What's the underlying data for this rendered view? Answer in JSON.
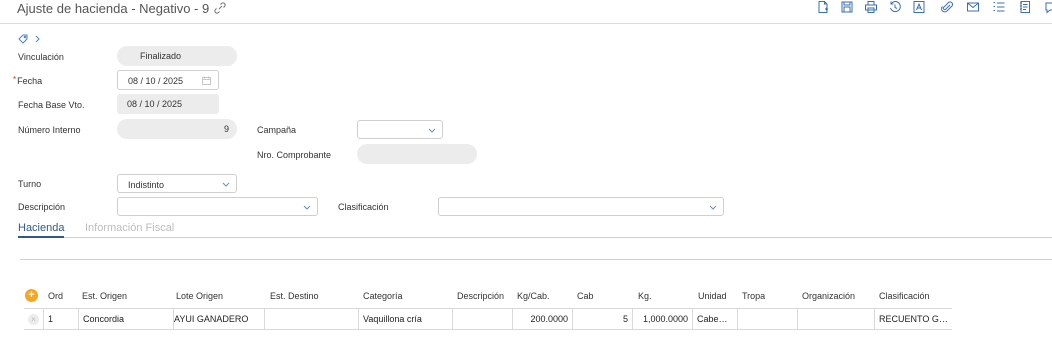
{
  "header": {
    "title": "Ajuste de hacienda - Negativo - 9",
    "toolbar": [
      {
        "name": "new-document-icon"
      },
      {
        "name": "save-icon"
      },
      {
        "name": "print-icon"
      },
      {
        "name": "history-icon"
      },
      {
        "name": "text-format-icon"
      },
      {
        "name": "attachment-icon"
      },
      {
        "name": "email-icon"
      },
      {
        "name": "list-icon"
      },
      {
        "name": "notebook-icon"
      },
      {
        "name": "comment-icon"
      }
    ]
  },
  "tags": {
    "tag_icon": "tag-icon",
    "chevron": "chevron-right-icon"
  },
  "form": {
    "vinculacion": {
      "label": "Vinculación",
      "value": "Finalizado"
    },
    "fecha": {
      "required_mark": "*",
      "label": "Fecha",
      "value": "08 / 10 / 2025"
    },
    "fecha_base_vto": {
      "label": "Fecha Base Vto.",
      "value": "08 / 10 / 2025"
    },
    "numero_interno": {
      "label": "Número Interno",
      "value": "9"
    },
    "campana": {
      "label": "Campaña",
      "value": ""
    },
    "nro_comprobante": {
      "label": "Nro. Comprobante",
      "value": ""
    },
    "turno": {
      "label": "Turno",
      "value": "Indistinto"
    },
    "descripcion": {
      "label": "Descripción",
      "value": ""
    },
    "clasificacion": {
      "label": "Clasificación",
      "value": ""
    }
  },
  "tabs": [
    {
      "label": "Hacienda",
      "active": true
    },
    {
      "label": "Información Fiscal",
      "active": false
    }
  ],
  "grid": {
    "columns": [
      "Ord",
      "Est. Origen",
      "Lote Origen",
      "Est. Destino",
      "Categoría",
      "Descripción",
      "Kg/Cab.",
      "Cab",
      "Kg.",
      "Unidad",
      "Tropa",
      "Organización",
      "Clasificación"
    ],
    "rows": [
      {
        "ord": "1",
        "est_origen": "Concordia",
        "lote_origen": "AYUI GANADERO",
        "est_destino": "",
        "categoria": "Vaquillona cría",
        "descripcion": "",
        "kg_cab": "200.0000",
        "cab": "5",
        "kg": "1,000.0000",
        "unidad": "Cabe…",
        "tropa": "",
        "organizacion": "",
        "clasificacion": "RECUENTO G…"
      }
    ],
    "add_icon": "plus-circle-icon",
    "delete_icon": "remove-row-icon"
  },
  "colors": {
    "accent": "#3a6fb4",
    "add_button": "#f5a623",
    "required": "#c0392b",
    "readonly_bg": "#ececec"
  }
}
